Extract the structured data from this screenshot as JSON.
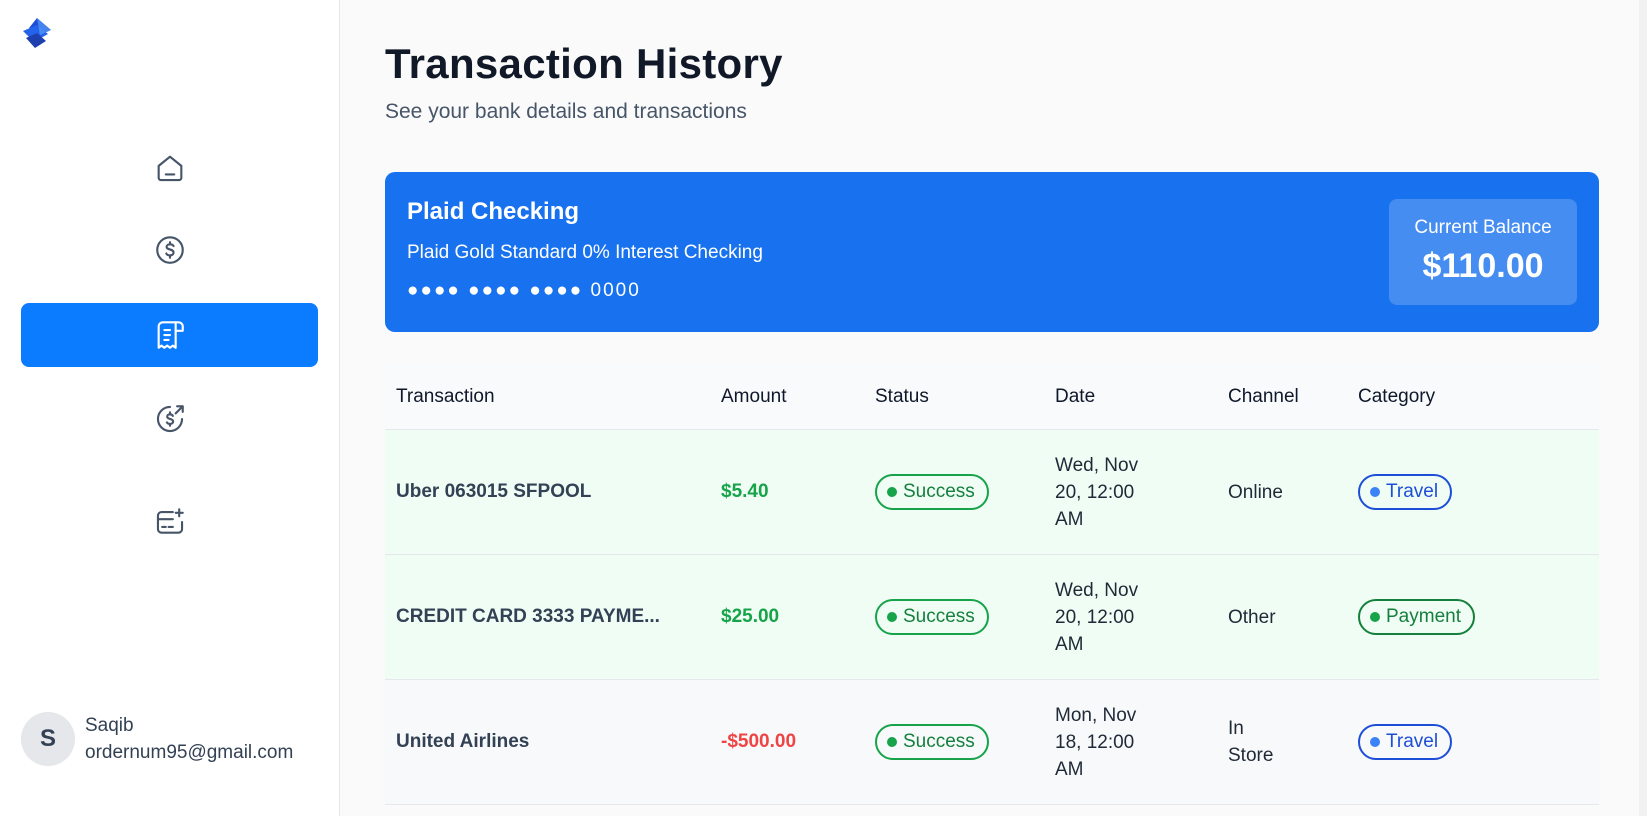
{
  "sidebar": {
    "nav": [
      {
        "icon": "home-icon",
        "active": false
      },
      {
        "icon": "dollar-circle-icon",
        "active": false
      },
      {
        "icon": "receipt-icon",
        "active": true
      },
      {
        "icon": "money-send-icon",
        "active": false
      },
      {
        "icon": "card-add-icon",
        "active": false
      }
    ],
    "user": {
      "initial": "S",
      "name": "Saqib",
      "email": "ordernum95@gmail.com"
    }
  },
  "header": {
    "title": "Transaction History",
    "subtitle": "See your bank details and transactions"
  },
  "account": {
    "name": "Plaid Checking",
    "official_name": "Plaid Gold Standard 0% Interest Checking",
    "mask": "●●●● ●●●● ●●●● 0000",
    "balance_label": "Current Balance",
    "balance": "$110.00"
  },
  "table": {
    "headers": [
      "Transaction",
      "Amount",
      "Status",
      "Date",
      "Channel",
      "Category"
    ],
    "rows": [
      {
        "name": "Uber 063015 SFPOOL",
        "amount": "$5.40",
        "status": "Success",
        "date": "Wed, Nov 20, 12:00 AM",
        "channel": "Online",
        "category": "Travel"
      },
      {
        "name": "CREDIT CARD 3333 PAYME...",
        "amount": "$25.00",
        "status": "Success",
        "date": "Wed, Nov 20, 12:00 AM",
        "channel": "Other",
        "category": "Payment"
      },
      {
        "name": "United Airlines",
        "amount": "-$500.00",
        "status": "Success",
        "date": "Mon, Nov 18, 12:00 AM",
        "channel": "In Store",
        "category": "Travel"
      }
    ]
  },
  "colors": {
    "accent": "#0b7bff",
    "card": "#1871ee",
    "positive": "#16a34a",
    "negative": "#ef4444"
  }
}
